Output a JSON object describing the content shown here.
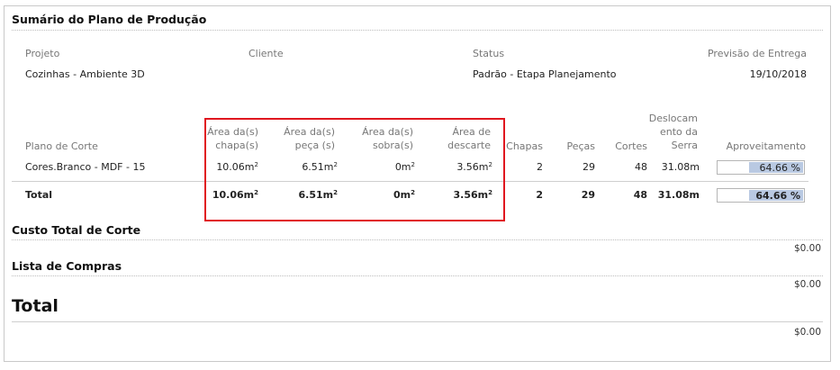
{
  "summary": {
    "title": "Sumário do Plano de Produção",
    "project_label": "Projeto",
    "project_value": "Cozinhas - Ambiente 3D",
    "client_label": "Cliente",
    "client_value": "",
    "status_label": "Status",
    "status_value": "Padrão - Etapa Planejamento",
    "delivery_label": "Previsão de Entrega",
    "delivery_value": "19/10/2018"
  },
  "table": {
    "headers": {
      "plan": "Plano de Corte",
      "chapa_area": "Área da(s) chapa(s)",
      "peca_area": "Área da(s) peça (s)",
      "sobra_area": "Área da(s) sobra(s)",
      "descarte_area": "Área de descarte",
      "chapas": "Chapas",
      "pecas": "Peças",
      "cortes": "Cortes",
      "deslocamento": "Deslocam ento da Serra",
      "aproveitamento": "Aproveitamento"
    },
    "rows": [
      {
        "plan": "Cores.Branco - MDF - 15",
        "chapa_area": "10.06m",
        "peca_area": "6.51m",
        "sobra_area": "0m",
        "descarte_area": "3.56m",
        "chapas": "2",
        "pecas": "29",
        "cortes": "48",
        "deslocamento": "31.08m",
        "aproveitamento": "64.66 %",
        "aproveitamento_value": 64.66
      }
    ],
    "total": {
      "label": "Total",
      "chapa_area": "10.06m",
      "peca_area": "6.51m",
      "sobra_area": "0m",
      "descarte_area": "3.56m",
      "chapas": "2",
      "pecas": "29",
      "cortes": "48",
      "deslocamento": "31.08m",
      "aproveitamento": "64.66 %",
      "aproveitamento_value": 64.66
    },
    "unit_superscript": "2"
  },
  "cost": {
    "title": "Custo Total de Corte",
    "value": "$0.00"
  },
  "purchases": {
    "title": "Lista de Compras",
    "value": "$0.00"
  },
  "grand_total": {
    "title": "Total",
    "value": "$0.00"
  },
  "colors": {
    "highlight_border": "#e0171f",
    "bar_fill": "#b9c9e2"
  }
}
